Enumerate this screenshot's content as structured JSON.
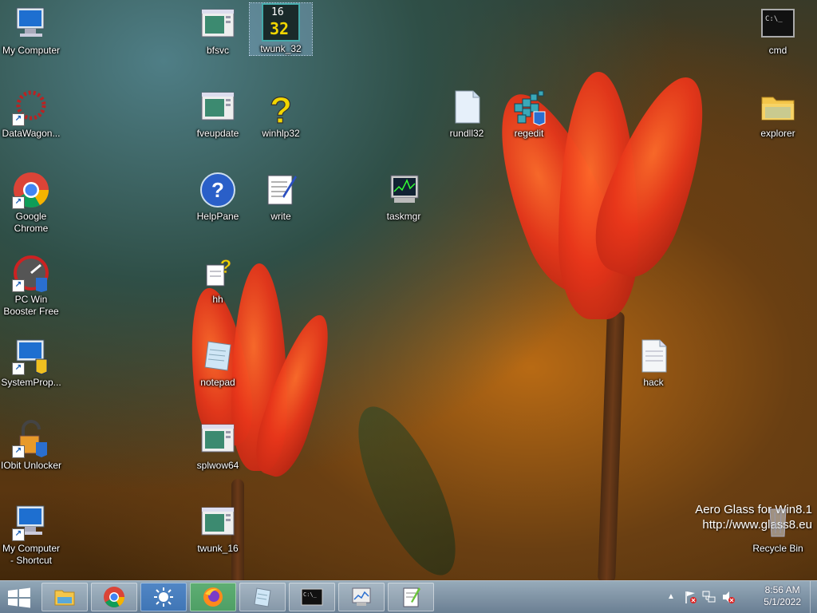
{
  "desktop": {
    "icons": [
      {
        "id": "my-computer",
        "label": "My Computer"
      },
      {
        "id": "datawagon",
        "label": "DataWagon..."
      },
      {
        "id": "google-chrome",
        "label": "Google Chrome"
      },
      {
        "id": "pc-win-booster",
        "label": "PC Win Booster Free"
      },
      {
        "id": "systemprop",
        "label": "SystemProp..."
      },
      {
        "id": "iobit-unlocker",
        "label": "IObit Unlocker"
      },
      {
        "id": "my-computer-shortcut",
        "label": "My Computer - Shortcut"
      },
      {
        "id": "bfsvc",
        "label": "bfsvc"
      },
      {
        "id": "fveupdate",
        "label": "fveupdate"
      },
      {
        "id": "helppane",
        "label": "HelpPane"
      },
      {
        "id": "hh",
        "label": "hh"
      },
      {
        "id": "notepad",
        "label": "notepad"
      },
      {
        "id": "splwow64",
        "label": "splwow64"
      },
      {
        "id": "twunk-16",
        "label": "twunk_16"
      },
      {
        "id": "twunk-32",
        "label": "twunk_32"
      },
      {
        "id": "winhlp32",
        "label": "winhlp32"
      },
      {
        "id": "write",
        "label": "write"
      },
      {
        "id": "taskmgr",
        "label": "taskmgr"
      },
      {
        "id": "rundll32",
        "label": "rundll32"
      },
      {
        "id": "regedit",
        "label": "regedit"
      },
      {
        "id": "hack",
        "label": "hack"
      },
      {
        "id": "cmd",
        "label": "cmd"
      },
      {
        "id": "explorer",
        "label": "explorer"
      },
      {
        "id": "recycle-bin",
        "label": "Recycle Bin"
      }
    ],
    "twunk32_badge": {
      "top": "16",
      "bottom": "32"
    }
  },
  "watermark": {
    "line1": "Aero Glass for Win8.1",
    "line2": "http://www.glass8.eu"
  },
  "taskbar": {
    "pinned": [
      "file-explorer",
      "chrome",
      "brightness",
      "firefox",
      "notepad",
      "command-prompt",
      "performance-monitor",
      "notepad-plus-plus"
    ],
    "tray_icons": [
      "show-hidden-icons",
      "action-center-flag-icon",
      "network-icon",
      "volume-muted-icon"
    ],
    "clock": {
      "time": "8:56 AM",
      "date": "5/1/2022"
    }
  },
  "colors": {
    "accent": "#1a5fb4",
    "taskbar": "#8aa8c4",
    "tulip": "#e8361a"
  }
}
